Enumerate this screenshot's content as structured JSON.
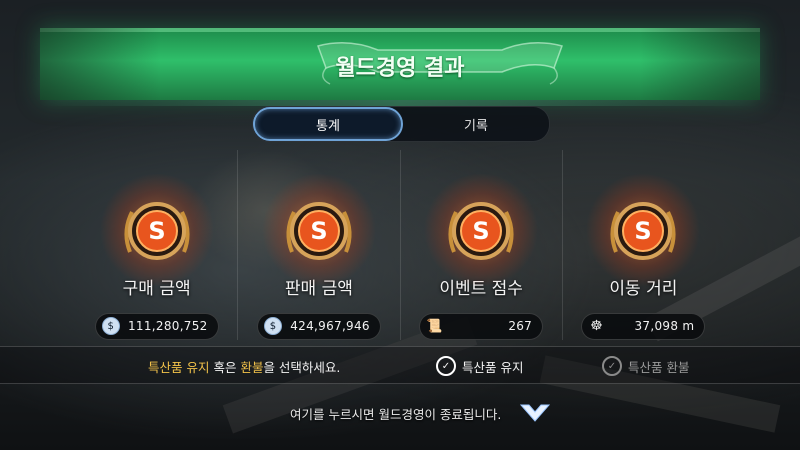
{
  "header": {
    "title": "월드경영 결과"
  },
  "tabs": [
    {
      "label": "통계",
      "active": true
    },
    {
      "label": "기록",
      "active": false
    }
  ],
  "stats": [
    {
      "label": "구매 금액",
      "grade": "S",
      "icon": "silver-coin-icon",
      "value": "111,280,752"
    },
    {
      "label": "판매 금액",
      "grade": "S",
      "icon": "silver-coin-icon",
      "value": "424,967,946"
    },
    {
      "label": "이벤트 점수",
      "grade": "S",
      "icon": "scroll-icon",
      "value": "267"
    },
    {
      "label": "이동 거리",
      "grade": "S",
      "icon": "wheel-icon",
      "value": "37,098 m"
    }
  ],
  "choice": {
    "message_part1": "특산품 유지",
    "message_part2": " 혹은 ",
    "message_part3": "환불",
    "message_part4": "을 선택하세요.",
    "keep_label": "특산품 유지",
    "refund_label": "특산품 환불"
  },
  "footer": {
    "message": "여기를 누르시면 월드경영이 종료됩니다."
  },
  "colors": {
    "banner_green": "#2fbf6a",
    "highlight_gold": "#f2c24a",
    "tab_active_border": "#6fa3d6",
    "emblem_orange": "#e8551e"
  }
}
